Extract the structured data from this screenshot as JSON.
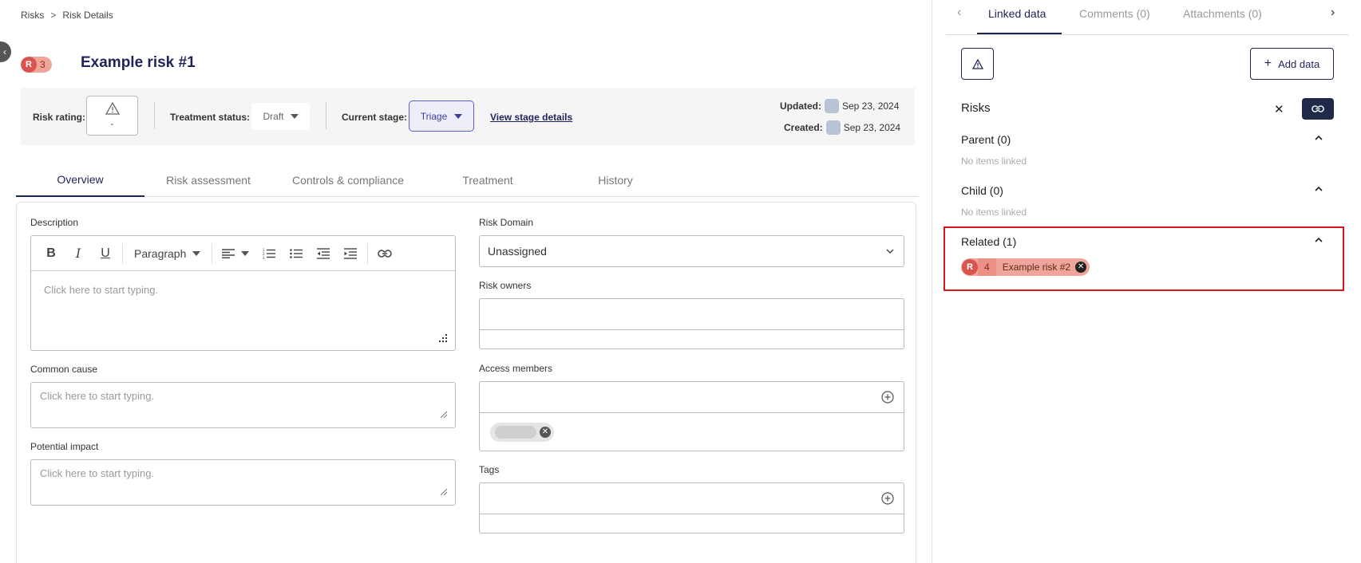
{
  "breadcrumb": {
    "root": "Risks",
    "separator": ">",
    "current": "Risk Details"
  },
  "risk": {
    "badge_letter": "R",
    "badge_count": "3",
    "title": "Example risk #1"
  },
  "infobar": {
    "rating_label": "Risk rating:",
    "rating_value": "-",
    "treatment_label": "Treatment status:",
    "treatment_value": "Draft",
    "stage_label": "Current stage:",
    "stage_value": "Triage",
    "view_stage_link": "View stage details",
    "updated_label": "Updated:",
    "updated_date": "Sep 23, 2024",
    "created_label": "Created:",
    "created_date": "Sep 23, 2024"
  },
  "tabs": [
    "Overview",
    "Risk assessment",
    "Controls & compliance",
    "Treatment",
    "History"
  ],
  "form": {
    "description_label": "Description",
    "paragraph_label": "Paragraph",
    "description_placeholder": "Click here to start typing.",
    "common_cause_label": "Common cause",
    "common_cause_placeholder": "Click here to start typing.",
    "potential_impact_label": "Potential impact",
    "potential_impact_placeholder": "Click here to start typing.",
    "risk_domain_label": "Risk Domain",
    "risk_domain_value": "Unassigned",
    "risk_owners_label": "Risk owners",
    "access_members_label": "Access members",
    "tags_label": "Tags"
  },
  "right_panel": {
    "tabs": [
      "Linked data",
      "Comments (0)",
      "Attachments (0)"
    ],
    "add_data_label": "Add data",
    "risks_title": "Risks",
    "parent_label": "Parent (0)",
    "parent_empty": "No items linked",
    "child_label": "Child (0)",
    "child_empty": "No items linked",
    "related_label": "Related (1)",
    "related_item": {
      "letter": "R",
      "count": "4",
      "name": "Example risk #2"
    }
  },
  "icons": {
    "warning": "warning-triangle-icon",
    "link": "link-icon",
    "close": "close-icon",
    "plus": "plus-icon",
    "chevron": "chevron-icon"
  },
  "colors": {
    "navy": "#1f2457",
    "risk_red": "#d9534f",
    "risk_salmon": "#f0a49a",
    "highlight_red": "#d9141e",
    "triage_purple": "#5b5fc7"
  }
}
